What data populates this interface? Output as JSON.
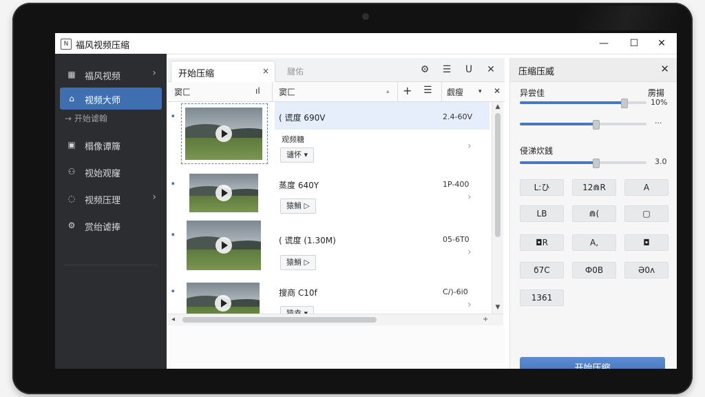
{
  "app": {
    "icon_glyph": "N",
    "title": "福风视频压缩",
    "window_controls": [
      "—",
      "☐",
      "✕"
    ]
  },
  "sidebar": {
    "items": [
      {
        "label": "福风视频",
        "icon": "film-icon",
        "glyph": "▦",
        "chevron": "›"
      },
      {
        "label": "视频大师",
        "icon": "home-icon",
        "glyph": "⌂",
        "active": true
      },
      {
        "label": "榻像谭簰",
        "icon": "image-icon",
        "glyph": "▣"
      },
      {
        "label": "视始观窿",
        "icon": "user-icon",
        "glyph": "⚇"
      },
      {
        "label": "视频压理",
        "icon": "spinner-icon",
        "glyph": "◌",
        "chevron": "›"
      },
      {
        "label": "赏绐谑捧",
        "icon": "gear-icon",
        "glyph": "⚙"
      }
    ],
    "sub_item": "→ 开始谑翰"
  },
  "list_panel": {
    "tabs": [
      {
        "label": "开始压缩",
        "close": "×"
      },
      {
        "label": "腱佑"
      }
    ],
    "toolbar_icons": [
      {
        "name": "settings-search-icon",
        "glyph": "⚙"
      },
      {
        "name": "list-icon",
        "glyph": "☰"
      },
      {
        "name": "magnet-icon",
        "glyph": "U"
      },
      {
        "name": "close-icon",
        "glyph": "✕"
      }
    ],
    "columns": {
      "col1": "窦匚",
      "col1_icon": "ıl",
      "col2": "窦匚",
      "col2_caret": "▴",
      "add": "+",
      "menu": "☰",
      "col3": "觑瘦",
      "col3_caret": "▾",
      "close": "✕"
    },
    "rows": [
      {
        "name": "( 谎度 690V",
        "size": "2.4-60V",
        "sub": "观频糖",
        "button": "谴怀 ▾",
        "chevron": "›",
        "selected": true
      },
      {
        "name": "蒸度 640Y",
        "size": "1P-400",
        "button": "猿鮹 ▷",
        "chevron": "›"
      },
      {
        "name": "( 谎度 (1.30M)",
        "size": "05-6T0",
        "button": "猿鮹 ▷",
        "chevron": "›"
      },
      {
        "name": "搜商 C10f",
        "size": "C/)-6i0",
        "button": "猿幸 ▾",
        "chevron": "›"
      }
    ],
    "scroll": {
      "up": "▲",
      "down": "▼",
      "left": "◂",
      "right": "+"
    }
  },
  "settings_panel": {
    "title": "压缩压威",
    "close": "✕",
    "quality_label": "异尝佳",
    "quality_value_label": "雳揚",
    "quality_value": "10%",
    "quality_level": 0.82,
    "second_level": 0.6,
    "second_value": "···",
    "speed_label": "侵涕炊銭",
    "speed_value": "3.0",
    "speed_level": 0.6,
    "chips": [
      "L:ひ",
      "12⋒R",
      "A",
      "LB",
      "⋒(",
      "▢",
      "◘R",
      "A,",
      "◘",
      "ϭ7C",
      "Ф0B",
      "Ә0ʌ",
      "1361"
    ],
    "start_button": "开始压缩"
  }
}
